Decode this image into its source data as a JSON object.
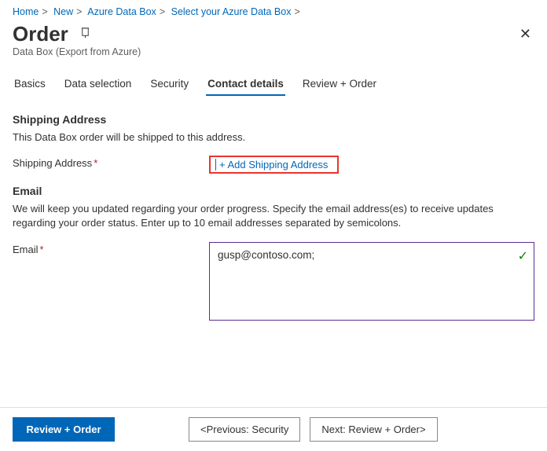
{
  "breadcrumb": [
    "Home",
    "New",
    "Azure Data Box",
    "Select your Azure Data Box"
  ],
  "page": {
    "title": "Order",
    "subtitle": "Data Box (Export from Azure)"
  },
  "tabs": [
    {
      "label": "Basics"
    },
    {
      "label": "Data selection"
    },
    {
      "label": "Security"
    },
    {
      "label": "Contact details"
    },
    {
      "label": "Review + Order"
    }
  ],
  "shipping": {
    "heading": "Shipping Address",
    "description": "This Data Box order will be shipped to this address.",
    "field_label": "Shipping Address",
    "add_link": "+ Add Shipping Address"
  },
  "email": {
    "heading": "Email",
    "description": "We will keep you updated regarding your order progress. Specify the email address(es) to receive updates regarding your order status. Enter up to 10 email addresses separated by semicolons.",
    "field_label": "Email",
    "value": "gusp@contoso.com;"
  },
  "footer": {
    "primary": "Review + Order",
    "prev": "<Previous: Security",
    "next": "Next: Review + Order>"
  }
}
